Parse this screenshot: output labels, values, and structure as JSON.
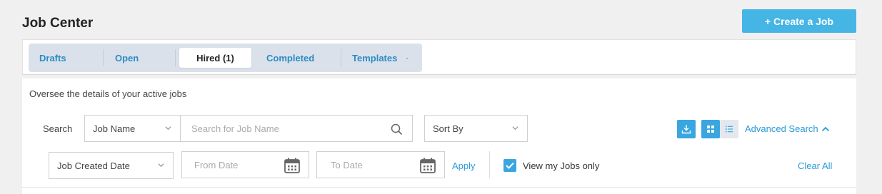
{
  "header": {
    "title": "Job Center",
    "create_button_label": "+ Create a Job"
  },
  "tabs": [
    {
      "label": "Drafts"
    },
    {
      "label": "Open"
    },
    {
      "label": "Hired (1)",
      "active": true
    },
    {
      "label": "Completed"
    },
    {
      "label": "Templates"
    }
  ],
  "content": {
    "description": "Oversee the details of your active jobs",
    "search_label": "Search",
    "search_field_select": "Job Name",
    "search_placeholder": "Search for Job Name",
    "sort_select": "Sort By",
    "advanced_search_label": "Advanced Search",
    "date_type_select": "Job Created Date",
    "from_date_placeholder": "From Date",
    "to_date_placeholder": "To Date",
    "apply_label": "Apply",
    "view_my_jobs_label": "View my Jobs only",
    "view_my_jobs_checked": true,
    "clear_all_label": "Clear All",
    "view_mode": "grid"
  },
  "colors": {
    "accent": "#45b5e6",
    "link": "#2a9ad8",
    "tab_bg": "#dbe1ea"
  },
  "icons": [
    "search-icon",
    "chevron-down-icon",
    "calendar-icon",
    "download-icon",
    "grid-view-icon",
    "list-view-icon",
    "chevron-up-icon",
    "checkmark-icon"
  ]
}
